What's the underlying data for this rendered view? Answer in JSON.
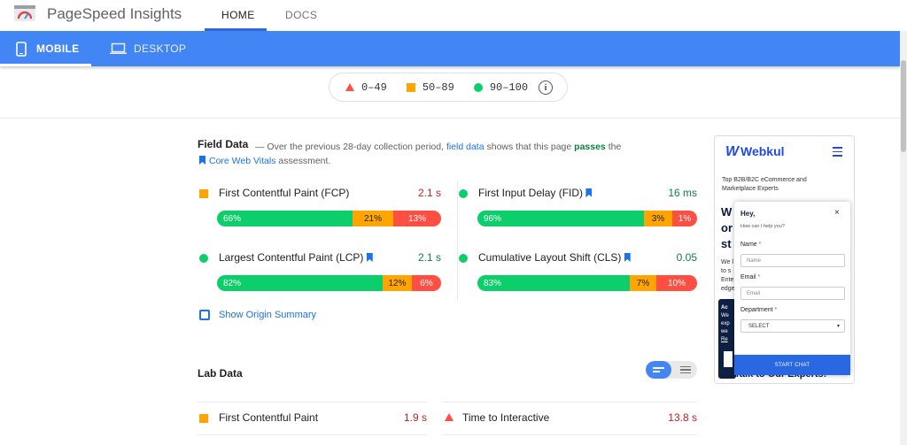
{
  "header": {
    "app_title": "PageSpeed Insights",
    "nav": [
      {
        "label": "HOME",
        "active": true
      },
      {
        "label": "DOCS",
        "active": false
      }
    ]
  },
  "device_tabs": [
    {
      "label": "MOBILE",
      "icon": "phone-icon",
      "active": true
    },
    {
      "label": "DESKTOP",
      "icon": "laptop-icon",
      "active": false
    }
  ],
  "legend": {
    "items": [
      {
        "range": "0–49",
        "shape": "triangle",
        "color": "#ff4e42"
      },
      {
        "range": "50–89",
        "shape": "square",
        "color": "#ffa400"
      },
      {
        "range": "90–100",
        "shape": "circle",
        "color": "#0cce6b"
      }
    ],
    "info_icon": "info-icon"
  },
  "field_data": {
    "title": "Field Data",
    "desc_prefix": "— Over the previous 28-day collection period,",
    "desc_link": "field data",
    "desc_mid": "shows that this page",
    "desc_status": "passes",
    "desc_suffix": "the",
    "cwv_link": "Core Web Vitals",
    "cwv_suffix": "assessment.",
    "metrics": [
      {
        "label": "First Contentful Paint (FCP)",
        "value": "2.1 s",
        "marker": "square",
        "cwv": false,
        "bar": [
          "66%",
          "21%",
          "13%"
        ]
      },
      {
        "label": "First Input Delay (FID)",
        "value": "16 ms",
        "marker": "circle",
        "cwv": true,
        "bar": [
          "96%",
          "3%",
          "1%"
        ]
      },
      {
        "label": "Largest Contentful Paint (LCP)",
        "value": "2.1 s",
        "marker": "circle",
        "cwv": true,
        "bar": [
          "82%",
          "12%",
          "6%"
        ]
      },
      {
        "label": "Cumulative Layout Shift (CLS)",
        "value": "0.05",
        "marker": "circle",
        "cwv": true,
        "bar": [
          "83%",
          "7%",
          "10%"
        ]
      }
    ],
    "origin_summary": "Show Origin Summary"
  },
  "lab_data": {
    "title": "Lab Data",
    "metrics": [
      {
        "label": "First Contentful Paint",
        "value": "1.9 s",
        "marker": "square"
      },
      {
        "label": "Time to Interactive",
        "value": "13.8 s",
        "marker": "triangle"
      }
    ]
  },
  "screenshot": {
    "brand": "Webkul",
    "tagline": "Top B2B/B2C eCommerce and Marketplace Experts",
    "hero_partial": [
      "W",
      "or",
      "st"
    ],
    "body_partial": [
      "We l",
      "to s",
      "Ente",
      "edge"
    ],
    "dark_partial": [
      "Ac",
      "We",
      "exp",
      "we",
      "Re"
    ],
    "talk_text": "Talk to Our Experts!",
    "chat": {
      "greeting": "Hey,",
      "help": "How can I help you?",
      "name_label": "Name",
      "name_placeholder": "Name",
      "email_label": "Email",
      "email_placeholder": "Email",
      "dept_label": "Department",
      "dept_value": "SELECT",
      "button": "START CHAT",
      "required_mark": "*",
      "close": "×"
    }
  },
  "colors": {
    "accent": "#4285f4",
    "good": "#0cce6b",
    "average": "#ffa400",
    "poor": "#ff4e42"
  }
}
